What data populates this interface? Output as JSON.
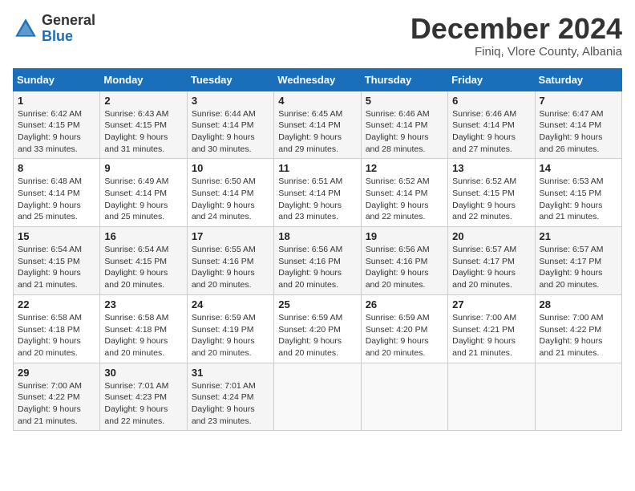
{
  "logo": {
    "general": "General",
    "blue": "Blue"
  },
  "title": {
    "month": "December 2024",
    "location": "Finiq, Vlore County, Albania"
  },
  "days_of_week": [
    "Sunday",
    "Monday",
    "Tuesday",
    "Wednesday",
    "Thursday",
    "Friday",
    "Saturday"
  ],
  "weeks": [
    [
      {
        "day": "1",
        "sunrise": "Sunrise: 6:42 AM",
        "sunset": "Sunset: 4:15 PM",
        "daylight": "Daylight: 9 hours and 33 minutes."
      },
      {
        "day": "2",
        "sunrise": "Sunrise: 6:43 AM",
        "sunset": "Sunset: 4:15 PM",
        "daylight": "Daylight: 9 hours and 31 minutes."
      },
      {
        "day": "3",
        "sunrise": "Sunrise: 6:44 AM",
        "sunset": "Sunset: 4:14 PM",
        "daylight": "Daylight: 9 hours and 30 minutes."
      },
      {
        "day": "4",
        "sunrise": "Sunrise: 6:45 AM",
        "sunset": "Sunset: 4:14 PM",
        "daylight": "Daylight: 9 hours and 29 minutes."
      },
      {
        "day": "5",
        "sunrise": "Sunrise: 6:46 AM",
        "sunset": "Sunset: 4:14 PM",
        "daylight": "Daylight: 9 hours and 28 minutes."
      },
      {
        "day": "6",
        "sunrise": "Sunrise: 6:46 AM",
        "sunset": "Sunset: 4:14 PM",
        "daylight": "Daylight: 9 hours and 27 minutes."
      },
      {
        "day": "7",
        "sunrise": "Sunrise: 6:47 AM",
        "sunset": "Sunset: 4:14 PM",
        "daylight": "Daylight: 9 hours and 26 minutes."
      }
    ],
    [
      {
        "day": "8",
        "sunrise": "Sunrise: 6:48 AM",
        "sunset": "Sunset: 4:14 PM",
        "daylight": "Daylight: 9 hours and 25 minutes."
      },
      {
        "day": "9",
        "sunrise": "Sunrise: 6:49 AM",
        "sunset": "Sunset: 4:14 PM",
        "daylight": "Daylight: 9 hours and 25 minutes."
      },
      {
        "day": "10",
        "sunrise": "Sunrise: 6:50 AM",
        "sunset": "Sunset: 4:14 PM",
        "daylight": "Daylight: 9 hours and 24 minutes."
      },
      {
        "day": "11",
        "sunrise": "Sunrise: 6:51 AM",
        "sunset": "Sunset: 4:14 PM",
        "daylight": "Daylight: 9 hours and 23 minutes."
      },
      {
        "day": "12",
        "sunrise": "Sunrise: 6:52 AM",
        "sunset": "Sunset: 4:14 PM",
        "daylight": "Daylight: 9 hours and 22 minutes."
      },
      {
        "day": "13",
        "sunrise": "Sunrise: 6:52 AM",
        "sunset": "Sunset: 4:15 PM",
        "daylight": "Daylight: 9 hours and 22 minutes."
      },
      {
        "day": "14",
        "sunrise": "Sunrise: 6:53 AM",
        "sunset": "Sunset: 4:15 PM",
        "daylight": "Daylight: 9 hours and 21 minutes."
      }
    ],
    [
      {
        "day": "15",
        "sunrise": "Sunrise: 6:54 AM",
        "sunset": "Sunset: 4:15 PM",
        "daylight": "Daylight: 9 hours and 21 minutes."
      },
      {
        "day": "16",
        "sunrise": "Sunrise: 6:54 AM",
        "sunset": "Sunset: 4:15 PM",
        "daylight": "Daylight: 9 hours and 20 minutes."
      },
      {
        "day": "17",
        "sunrise": "Sunrise: 6:55 AM",
        "sunset": "Sunset: 4:16 PM",
        "daylight": "Daylight: 9 hours and 20 minutes."
      },
      {
        "day": "18",
        "sunrise": "Sunrise: 6:56 AM",
        "sunset": "Sunset: 4:16 PM",
        "daylight": "Daylight: 9 hours and 20 minutes."
      },
      {
        "day": "19",
        "sunrise": "Sunrise: 6:56 AM",
        "sunset": "Sunset: 4:16 PM",
        "daylight": "Daylight: 9 hours and 20 minutes."
      },
      {
        "day": "20",
        "sunrise": "Sunrise: 6:57 AM",
        "sunset": "Sunset: 4:17 PM",
        "daylight": "Daylight: 9 hours and 20 minutes."
      },
      {
        "day": "21",
        "sunrise": "Sunrise: 6:57 AM",
        "sunset": "Sunset: 4:17 PM",
        "daylight": "Daylight: 9 hours and 20 minutes."
      }
    ],
    [
      {
        "day": "22",
        "sunrise": "Sunrise: 6:58 AM",
        "sunset": "Sunset: 4:18 PM",
        "daylight": "Daylight: 9 hours and 20 minutes."
      },
      {
        "day": "23",
        "sunrise": "Sunrise: 6:58 AM",
        "sunset": "Sunset: 4:18 PM",
        "daylight": "Daylight: 9 hours and 20 minutes."
      },
      {
        "day": "24",
        "sunrise": "Sunrise: 6:59 AM",
        "sunset": "Sunset: 4:19 PM",
        "daylight": "Daylight: 9 hours and 20 minutes."
      },
      {
        "day": "25",
        "sunrise": "Sunrise: 6:59 AM",
        "sunset": "Sunset: 4:20 PM",
        "daylight": "Daylight: 9 hours and 20 minutes."
      },
      {
        "day": "26",
        "sunrise": "Sunrise: 6:59 AM",
        "sunset": "Sunset: 4:20 PM",
        "daylight": "Daylight: 9 hours and 20 minutes."
      },
      {
        "day": "27",
        "sunrise": "Sunrise: 7:00 AM",
        "sunset": "Sunset: 4:21 PM",
        "daylight": "Daylight: 9 hours and 21 minutes."
      },
      {
        "day": "28",
        "sunrise": "Sunrise: 7:00 AM",
        "sunset": "Sunset: 4:22 PM",
        "daylight": "Daylight: 9 hours and 21 minutes."
      }
    ],
    [
      {
        "day": "29",
        "sunrise": "Sunrise: 7:00 AM",
        "sunset": "Sunset: 4:22 PM",
        "daylight": "Daylight: 9 hours and 21 minutes."
      },
      {
        "day": "30",
        "sunrise": "Sunrise: 7:01 AM",
        "sunset": "Sunset: 4:23 PM",
        "daylight": "Daylight: 9 hours and 22 minutes."
      },
      {
        "day": "31",
        "sunrise": "Sunrise: 7:01 AM",
        "sunset": "Sunset: 4:24 PM",
        "daylight": "Daylight: 9 hours and 23 minutes."
      },
      null,
      null,
      null,
      null
    ]
  ]
}
